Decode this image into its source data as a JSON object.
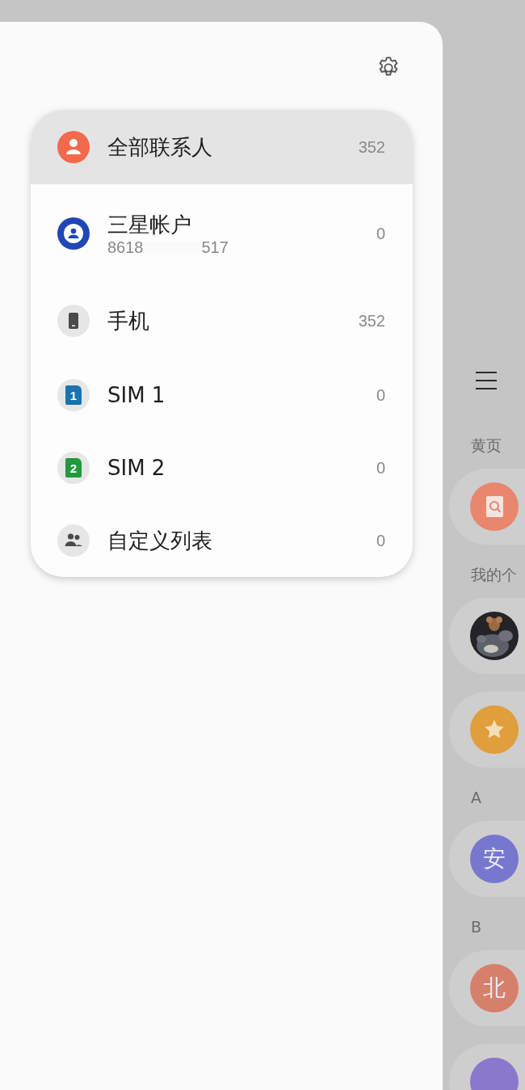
{
  "accounts": [
    {
      "kind": "all",
      "label": "全部联系人",
      "count": "352",
      "selected": true
    },
    {
      "kind": "samsung",
      "label": "三星帐户",
      "subtitle_parts": [
        "8618",
        "517"
      ],
      "count": "0",
      "selected": false
    },
    {
      "kind": "phone",
      "label": "手机",
      "count": "352",
      "selected": false
    },
    {
      "kind": "sim",
      "label": "SIM 1",
      "sim_number": "1",
      "color": "#1a72b0",
      "count": "0",
      "selected": false
    },
    {
      "kind": "sim",
      "label": "SIM 2",
      "sim_number": "2",
      "color": "#1f9a3c",
      "count": "0",
      "selected": false
    },
    {
      "kind": "group",
      "label": "自定义列表",
      "count": "0",
      "selected": false
    }
  ],
  "behind": [
    {
      "kind": "section",
      "label": "黄页"
    },
    {
      "kind": "book",
      "color": "#e8876d"
    },
    {
      "kind": "section",
      "label": "我的个"
    },
    {
      "kind": "picture"
    },
    {
      "kind": "star",
      "color": "#e09e3c"
    },
    {
      "kind": "section",
      "label": "A"
    },
    {
      "kind": "letter",
      "letter": "安",
      "color": "#7777d0"
    },
    {
      "kind": "section",
      "label": "B"
    },
    {
      "kind": "letter",
      "letter": "北",
      "color": "#d6806c"
    },
    {
      "kind": "letter",
      "color": "#8a78cc"
    }
  ]
}
